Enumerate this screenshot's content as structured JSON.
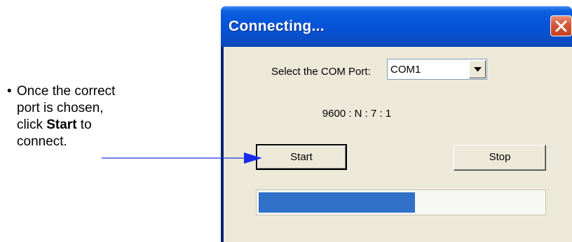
{
  "callout": {
    "line1": "Once the correct",
    "line2": "port is chosen,",
    "line3_pre": "click ",
    "line3_bold": "Start",
    "line3_post": " to",
    "line4": "connect.",
    "bullet": "•"
  },
  "dialog": {
    "title": "Connecting...",
    "port_label": "Select the COM Port:",
    "port_value": "COM1",
    "serial_settings": "9600 : N : 7 : 1",
    "start_label": "Start",
    "stop_label": "Stop",
    "progress_fraction": 0.55
  },
  "colors": {
    "titlebar": "#0553d8",
    "close_button": "#d65a3a",
    "client_background": "#ece9d8",
    "progress_fill": "#3170c9",
    "arrow": "#2233dd"
  },
  "icons": {
    "close": "close-x-icon",
    "dropdown": "chevron-down-icon",
    "callout_arrow": "arrow-right-icon"
  }
}
